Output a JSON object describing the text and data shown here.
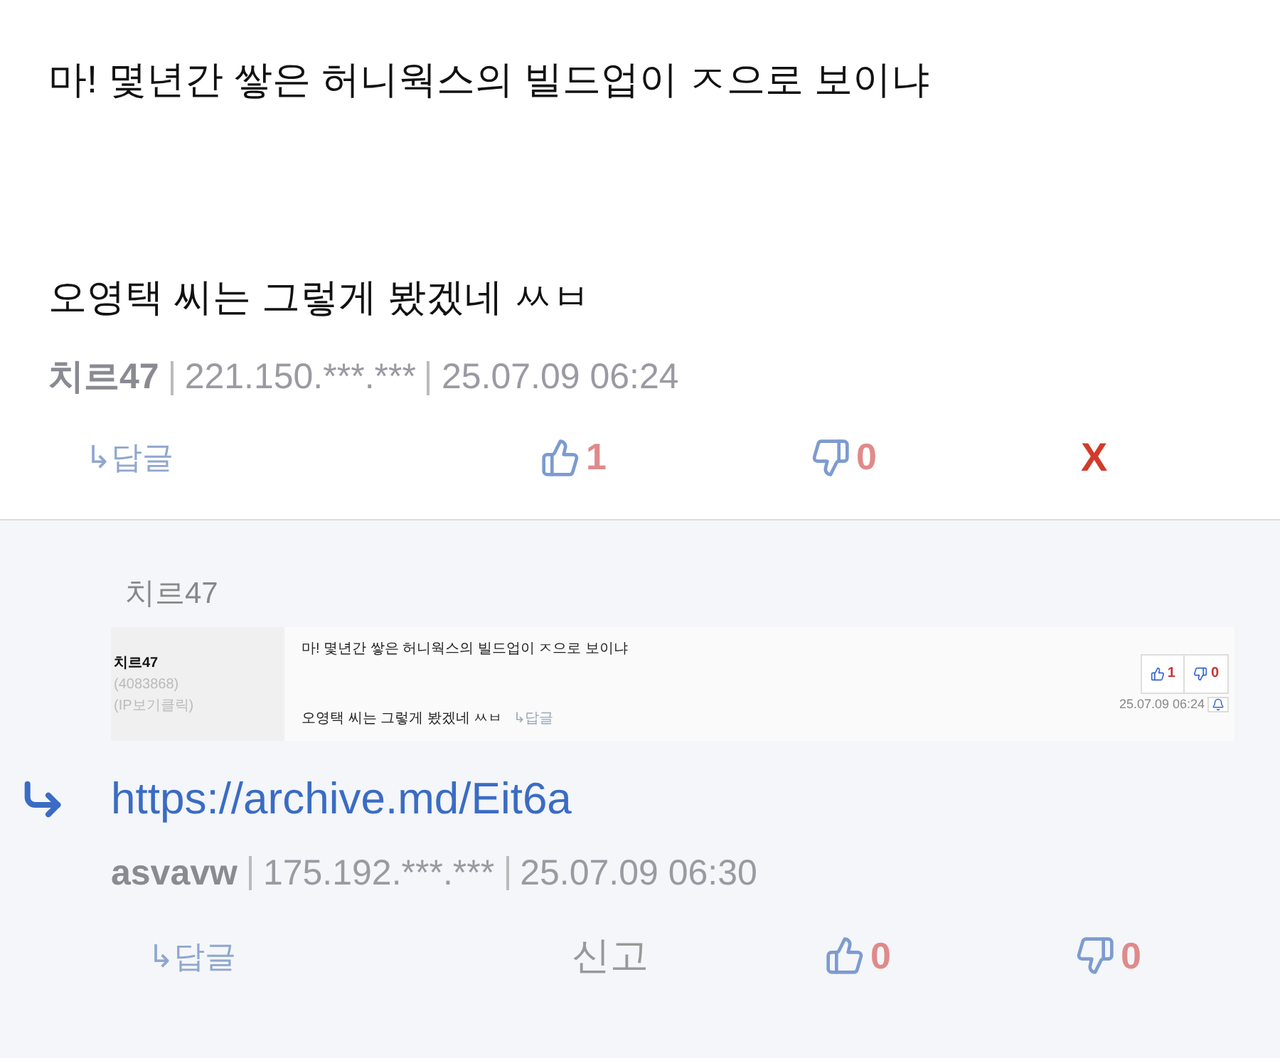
{
  "comment": {
    "lines": [
      "마! 몇년간 쌓은 허니웍스의 빌드업이 ㅈ으로 보이냐",
      "오영택 씨는 그렇게 봤겠네 ㅆㅂ"
    ],
    "author": "치르47",
    "ip": "221.150.***.***",
    "date": "25.07.09 06:24",
    "reply_label": "↳답글",
    "up": "1",
    "down": "0",
    "delete": "X"
  },
  "reply": {
    "quote_author": "치르47",
    "quoted": {
      "author": "치르47",
      "user_id": "(4083868)",
      "ip_hint": "(IP보기클릭)",
      "lines": [
        "마! 몇년간 쌓은 허니웍스의 빌드업이 ㅈ으로 보이냐",
        "오영택 씨는 그렇게 봤겠네 ㅆㅂ"
      ],
      "reply_label": "↳답글",
      "up": "1",
      "down": "0",
      "date": "25.07.09 06:24"
    },
    "link": "https://archive.md/Eit6a",
    "author": "asvavw",
    "ip": "175.192.***.***",
    "date": "25.07.09 06:30",
    "reply_label": "↳답글",
    "report": "신고",
    "up": "0",
    "down": "0"
  }
}
